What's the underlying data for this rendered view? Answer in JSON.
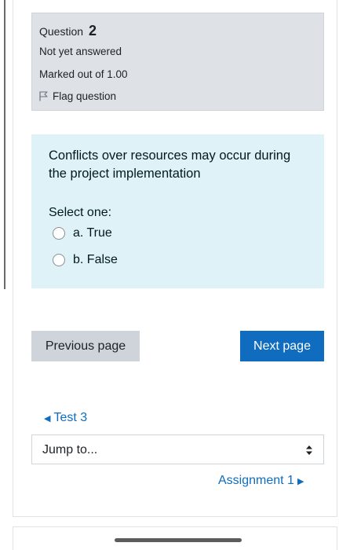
{
  "question_info": {
    "question_word": "Question",
    "question_number": "2",
    "state": "Not yet answered",
    "grade": "Marked out of 1.00",
    "flag_label": "Flag question"
  },
  "question": {
    "prompt": "Conflicts over resources may occur during the project implementation",
    "instruction": "Select one:",
    "answers": [
      {
        "label": "a. True",
        "selected": false
      },
      {
        "label": "b. False",
        "selected": false
      }
    ]
  },
  "navigation": {
    "previous_label": "Previous page",
    "next_label": "Next page"
  },
  "activity_nav": {
    "previous_activity": "Test 3",
    "jump_placeholder": "Jump to...",
    "next_activity": "Assignment 1"
  },
  "colors": {
    "accent": "#0f6cbf",
    "info_bg": "#dee2e6",
    "question_bg": "#def2f8",
    "secondary_button": "#ced4da"
  },
  "icons": {
    "flag": "flag-icon",
    "radio": "radio-button",
    "prev_arrow": "triangle-left-icon",
    "next_arrow": "triangle-right-icon",
    "select_chevron": "up-down-chevron-icon"
  }
}
